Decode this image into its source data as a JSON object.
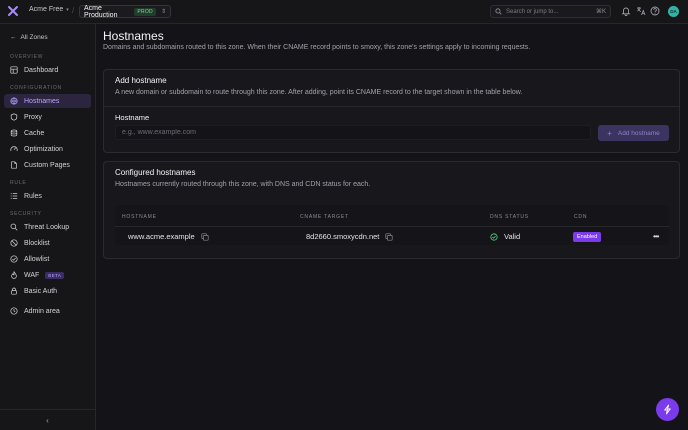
{
  "topbar": {
    "org_name": "Acme Free",
    "zone_name": "Acme Production",
    "zone_badge": "PROD",
    "search_placeholder": "Search or jump to...",
    "search_shortcut": "⌘K",
    "avatar_initials": "DA"
  },
  "sidebar": {
    "back_label": "All Zones",
    "sections": {
      "overview": "OVERVIEW",
      "configuration": "CONFIGURATION",
      "rule": "RULE",
      "security": "SECURITY"
    },
    "items": {
      "dashboard": "Dashboard",
      "hostnames": "Hostnames",
      "proxy": "Proxy",
      "cache": "Cache",
      "optimization": "Optimization",
      "custom_pages": "Custom Pages",
      "rules": "Rules",
      "threat_lookup": "Threat Lookup",
      "blocklist": "Blocklist",
      "allowlist": "Allowlist",
      "waf": "WAF",
      "waf_badge": "BETA",
      "basic_auth": "Basic Auth",
      "admin_area": "Admin area"
    },
    "collapse_glyph": "‹"
  },
  "page": {
    "title": "Hostnames",
    "subtitle": "Domains and subdomains routed to this zone. When their CNAME record points to smoxy, this zone's settings apply to incoming requests."
  },
  "add_card": {
    "title": "Add hostname",
    "description": "A new domain or subdomain to route through this zone. After adding, point its CNAME record to the target shown in the table below.",
    "field_label": "Hostname",
    "input_placeholder": "e.g., www.example.com",
    "input_value": "",
    "button_label": "Add hostname"
  },
  "configured_card": {
    "title": "Configured hostnames",
    "description": "Hostnames currently routed through this zone, with DNS and CDN status for each.",
    "columns": [
      "HOSTNAME",
      "CNAME TARGET",
      "DNS STATUS",
      "CDN"
    ],
    "rows": [
      {
        "hostname": "www.acme.example",
        "cname_target": "8d2660.smoxycdn.net",
        "dns_status": "Valid",
        "cdn": "Enabled"
      }
    ]
  },
  "colors": {
    "accent": "#7c3aed",
    "valid": "#4ade80",
    "prod_badge": "#7ddc9b"
  }
}
